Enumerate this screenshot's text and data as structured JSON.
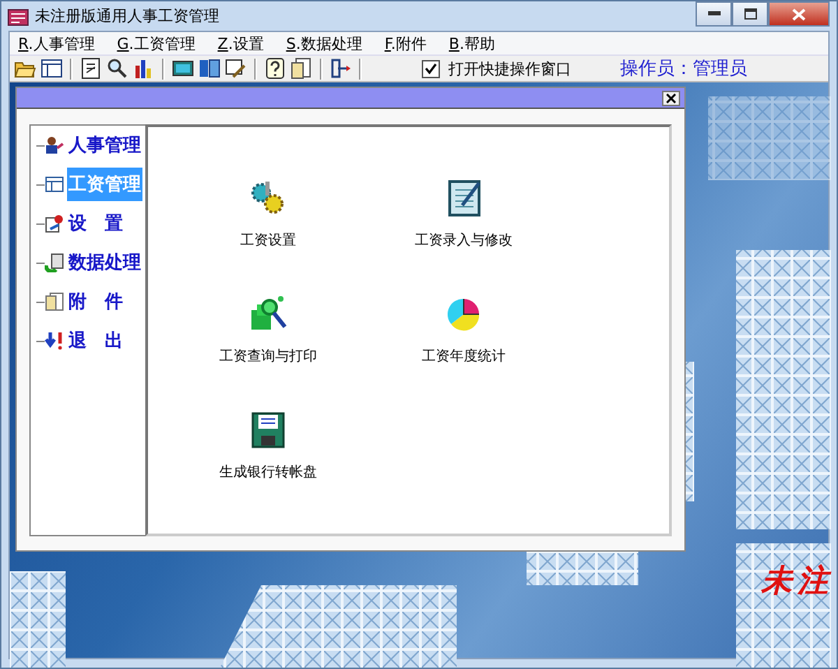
{
  "window": {
    "title": "未注册版通用人事工资管理"
  },
  "menu": [
    "R.人事管理",
    "G.工资管理",
    "Z.设置",
    "S.数据处理",
    "F.附件",
    "B.帮助"
  ],
  "toolbar": {
    "quick_window": {
      "label": "打开快捷操作窗口",
      "checked": true
    },
    "operator": "操作员：管理员"
  },
  "panel": {
    "nav": [
      {
        "label": "人事管理",
        "selected": false
      },
      {
        "label": "工资管理",
        "selected": true
      },
      {
        "label": "设　置",
        "selected": false
      },
      {
        "label": "数据处理",
        "selected": false
      },
      {
        "label": "附　件",
        "selected": false
      },
      {
        "label": "退　出",
        "selected": false
      }
    ],
    "functions": [
      {
        "label": "工资设置"
      },
      {
        "label": "工资录入与修改"
      },
      {
        "label": "工资查询与打印"
      },
      {
        "label": "工资年度统计"
      },
      {
        "label": "生成银行转帐盘"
      }
    ]
  },
  "unregistered_mark": "未注"
}
